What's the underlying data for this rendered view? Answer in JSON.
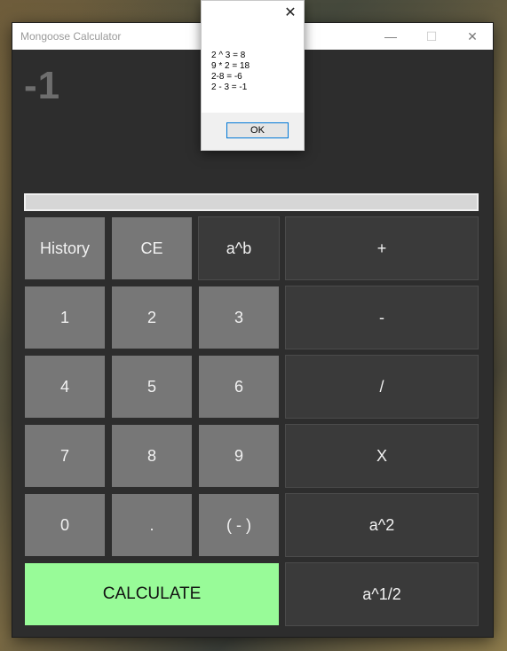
{
  "window": {
    "title": "Mongoose Calculator",
    "controls": {
      "minimize": "—",
      "maximize": "☐",
      "close": "✕"
    }
  },
  "display": {
    "value": "-1"
  },
  "buttons": {
    "history": "History",
    "ce": "CE",
    "power": "a^b",
    "plus": "+",
    "one": "1",
    "two": "2",
    "three": "3",
    "minus": "-",
    "four": "4",
    "five": "5",
    "six": "6",
    "divide": "/",
    "seven": "7",
    "eight": "8",
    "nine": "9",
    "multiply": "X",
    "zero": "0",
    "dot": ".",
    "negate": "( - )",
    "square": "a^2",
    "calculate": "CALCULATE",
    "sqrt": "a^1/2"
  },
  "dialog": {
    "close": "✕",
    "lines": [
      "2 ^ 3 = 8",
      "9 * 2 = 18",
      "2-8 = -6",
      "2 - 3 = -1"
    ],
    "ok": "OK"
  },
  "colors": {
    "accent_green": "#98fb98",
    "light_button": "#777777",
    "dark_button": "#3a3a3a"
  }
}
